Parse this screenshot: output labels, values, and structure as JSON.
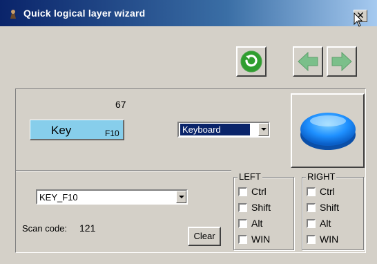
{
  "window": {
    "title": "Quick logical layer wizard",
    "close_label": "✕"
  },
  "toolbar": {
    "refresh_icon": "refresh-icon",
    "back_icon": "arrow-left-icon",
    "forward_icon": "arrow-right-icon",
    "accent": "#33a833",
    "disabled_arrow": "#7bbf8a"
  },
  "key_panel": {
    "count": "67",
    "key_label": "Key",
    "key_sub": "F10",
    "key_color": "#87ceeb",
    "device_select": "Keyboard",
    "action_button_icon": "blue-round-button-icon"
  },
  "mapping": {
    "key_select": "KEY_F10",
    "scan_code_label": "Scan code:",
    "scan_code_value": "121",
    "clear_label": "Clear"
  },
  "modifiers": {
    "left": {
      "title": "LEFT",
      "items": [
        {
          "label": "Ctrl",
          "checked": false
        },
        {
          "label": "Shift",
          "checked": false
        },
        {
          "label": "Alt",
          "checked": false
        },
        {
          "label": "WIN",
          "checked": false
        }
      ]
    },
    "right": {
      "title": "RIGHT",
      "items": [
        {
          "label": "Ctrl",
          "checked": false
        },
        {
          "label": "Shift",
          "checked": false
        },
        {
          "label": "Alt",
          "checked": false
        },
        {
          "label": "WIN",
          "checked": false
        }
      ]
    }
  }
}
